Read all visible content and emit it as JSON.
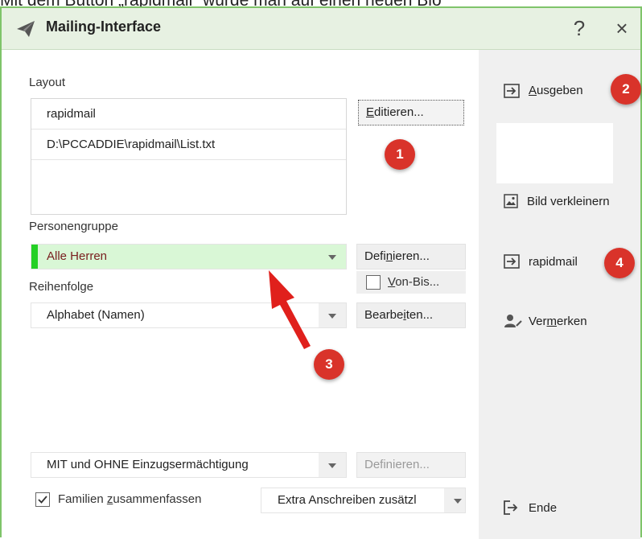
{
  "top_caption": "Mit dem Button „rapidmail“ wurde man auf einen neuen Blö",
  "window": {
    "title": "Mailing-Interface",
    "help_label": "?",
    "close_label": "×"
  },
  "layout": {
    "label": "Layout",
    "items": [
      "rapidmail",
      "D:\\PCCADDIE\\rapidmail\\List.txt"
    ],
    "edit_button": {
      "pre": "",
      "accel": "E",
      "post": "ditieren..."
    }
  },
  "persons": {
    "label": "Personengruppe",
    "selected": "Alle Herren",
    "define_button": {
      "pre": "Defi",
      "accel": "n",
      "post": "ieren..."
    },
    "range_checkbox": {
      "pre": "",
      "accel": "V",
      "post": "on-Bis...",
      "checked": false
    }
  },
  "order": {
    "label": "Reihenfolge",
    "selected": "Alphabet (Namen)",
    "edit_button": {
      "pre": "Bearbe",
      "accel": "i",
      "post": "ten..."
    }
  },
  "direct_debit": {
    "selected": "MIT und OHNE Einzugsermächtigung",
    "define_button": "Definieren..."
  },
  "families": {
    "checkbox": {
      "pre": "Familien ",
      "accel": "z",
      "post": "usammenfassen",
      "checked": true
    },
    "extra_select": "Extra Anschreiben zusätzl"
  },
  "right_pane": {
    "output_button": {
      "pre": "",
      "accel": "A",
      "post": "usgeben"
    },
    "shrink_image_button": "Bild verkleinern",
    "rapidmail_button": "rapidmail",
    "note_button": {
      "pre": "Ver",
      "accel": "m",
      "post": "erken"
    },
    "end_button": "Ende"
  },
  "annotations": {
    "badge_1": "1",
    "badge_2": "2",
    "badge_3": "3",
    "badge_4": "4",
    "badge_color": "#d9332a"
  },
  "colors": {
    "window_border": "#7fc46a",
    "titlebar": "#e7f1e2",
    "selected_group_bg": "#d9f7d6",
    "selected_group_marker": "#24d024",
    "selected_group_text": "#7a2020"
  }
}
